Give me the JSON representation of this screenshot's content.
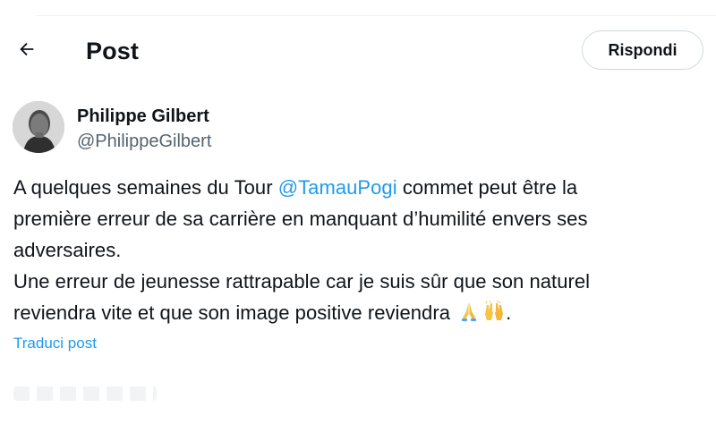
{
  "header": {
    "title": "Post",
    "back_icon": "arrow-left-icon",
    "reply_label": "Rispondi"
  },
  "author": {
    "name": "Philippe Gilbert",
    "handle": "@PhilippeGilbert",
    "avatar_icon": "avatar-photo"
  },
  "tweet": {
    "line1_before": "A quelques semaines du Tour ",
    "mention": "@TamauPogi",
    "line1_after": " commet peut être la",
    "line2": "première erreur de sa carrière en manquant d’humilité envers ses",
    "line3": "adversaires.",
    "line4": "Une erreur de jeunesse rattrapable car je suis sûr que son naturel",
    "line5_before": "reviendra vite et que son image positive reviendra ",
    "emojis": [
      "folded-hands-emoji",
      "raising-hands-emoji"
    ],
    "line5_after": "."
  },
  "translate": {
    "label": "Traduci post"
  },
  "colors": {
    "accent": "#1d9bf0",
    "text": "#0f1419",
    "secondary_text": "#536471",
    "border": "#cfd9de"
  }
}
